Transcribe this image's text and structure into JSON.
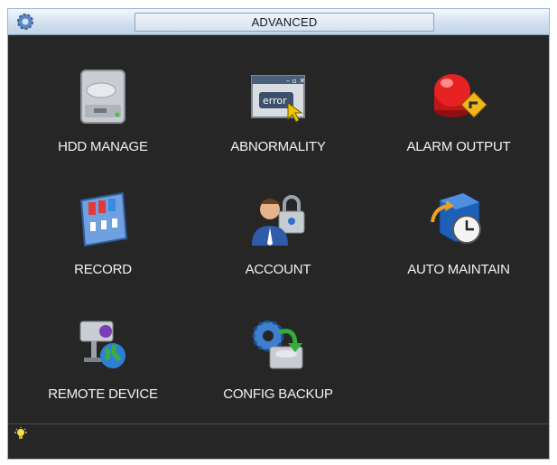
{
  "window": {
    "title": "ADVANCED"
  },
  "menu": {
    "items": [
      {
        "id": "hdd-manage",
        "label": "HDD MANAGE",
        "icon": "hdd-icon"
      },
      {
        "id": "abnormality",
        "label": "ABNORMALITY",
        "icon": "error-window-icon"
      },
      {
        "id": "alarm-output",
        "label": "ALARM OUTPUT",
        "icon": "alarm-beacon-icon"
      },
      {
        "id": "record",
        "label": "RECORD",
        "icon": "record-panel-icon"
      },
      {
        "id": "account",
        "label": "ACCOUNT",
        "icon": "user-lock-icon"
      },
      {
        "id": "auto-maintain",
        "label": "AUTO MAINTAIN",
        "icon": "maintain-clock-icon"
      },
      {
        "id": "remote-device",
        "label": "REMOTE DEVICE",
        "icon": "camera-globe-icon"
      },
      {
        "id": "config-backup",
        "label": "CONFIG BACKUP",
        "icon": "gear-backup-icon"
      }
    ]
  },
  "status": {
    "icon": "lightbulb-icon"
  },
  "colors": {
    "background": "#262626",
    "titlebar": "#d2e0ef",
    "label": "#f2f2f2",
    "accent_blue": "#2f6fc9"
  }
}
